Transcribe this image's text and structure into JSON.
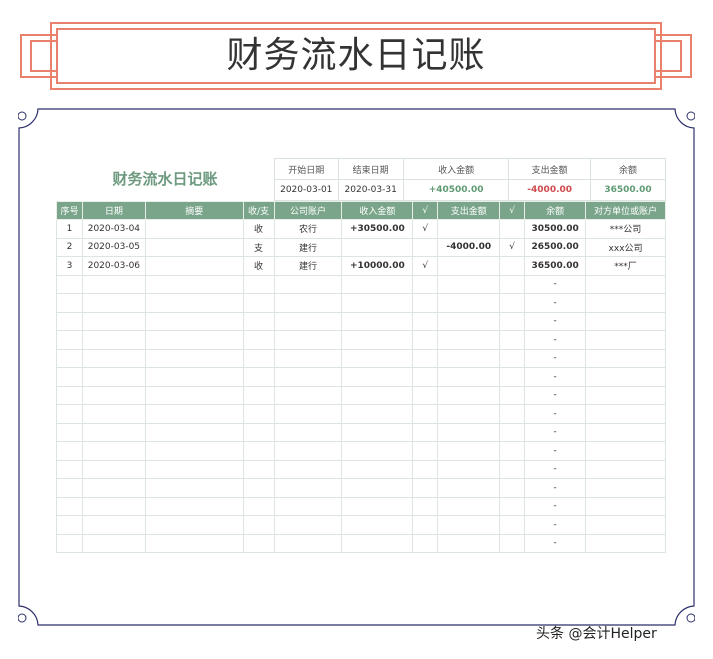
{
  "banner": {
    "title": "财务流水日记账"
  },
  "sheet": {
    "title": "财务流水日记账",
    "summary": {
      "labels": [
        "开始日期",
        "结束日期",
        "收入金额",
        "支出金额",
        "余额"
      ],
      "values": [
        "2020-03-01",
        "2020-03-31",
        "+40500.00",
        "-4000.00",
        "36500.00"
      ]
    },
    "columns": [
      "序号",
      "日期",
      "摘要",
      "收/支",
      "公司账户",
      "收入金额",
      "√",
      "支出金额",
      "√",
      "余额",
      "对方单位或账户"
    ],
    "rows": [
      [
        "1",
        "2020-03-04",
        "",
        "收",
        "农行",
        "+30500.00",
        "√",
        "",
        "",
        "30500.00",
        "***公司"
      ],
      [
        "2",
        "2020-03-05",
        "",
        "支",
        "建行",
        "",
        "",
        "-4000.00",
        "√",
        "26500.00",
        "xxx公司"
      ],
      [
        "3",
        "2020-03-06",
        "",
        "收",
        "建行",
        "+10000.00",
        "√",
        "",
        "",
        "36500.00",
        "***厂"
      ]
    ],
    "empty_row_balance": "-",
    "empty_row_count": 15
  },
  "watermark": "头条 @会计Helper",
  "colors": {
    "accent_green": "#7aa58a",
    "title_green": "#6d9a7f",
    "banner_border": "#e8806a",
    "frame": "#2c2f6b",
    "negative": "#d0494c"
  }
}
